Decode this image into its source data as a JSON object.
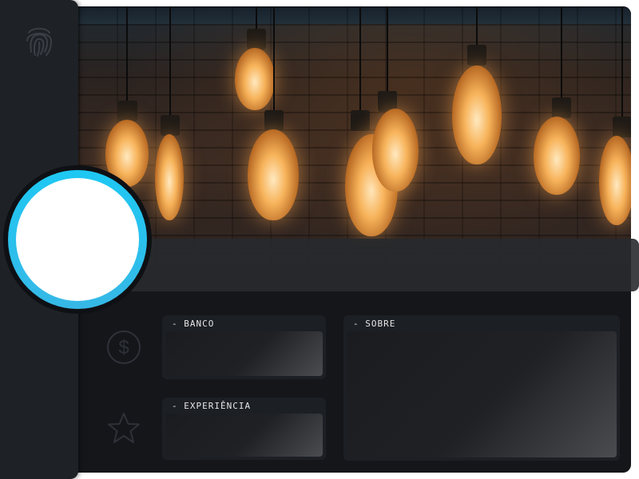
{
  "cards": {
    "banco": {
      "title": "- BANCO"
    },
    "experiencia": {
      "title": "- EXPERIÊNCIA"
    },
    "sobre": {
      "title": "- SOBRE"
    }
  },
  "icons": {
    "sidebar_top": "fingerprint-icon",
    "side_1": "dollar-icon",
    "side_2": "star-icon"
  },
  "colors": {
    "avatar_ring": "#1ec8f3",
    "panel_bg": "#14161a",
    "sidebar_bg": "#1e2126",
    "card_bg": "#1c1f24"
  }
}
